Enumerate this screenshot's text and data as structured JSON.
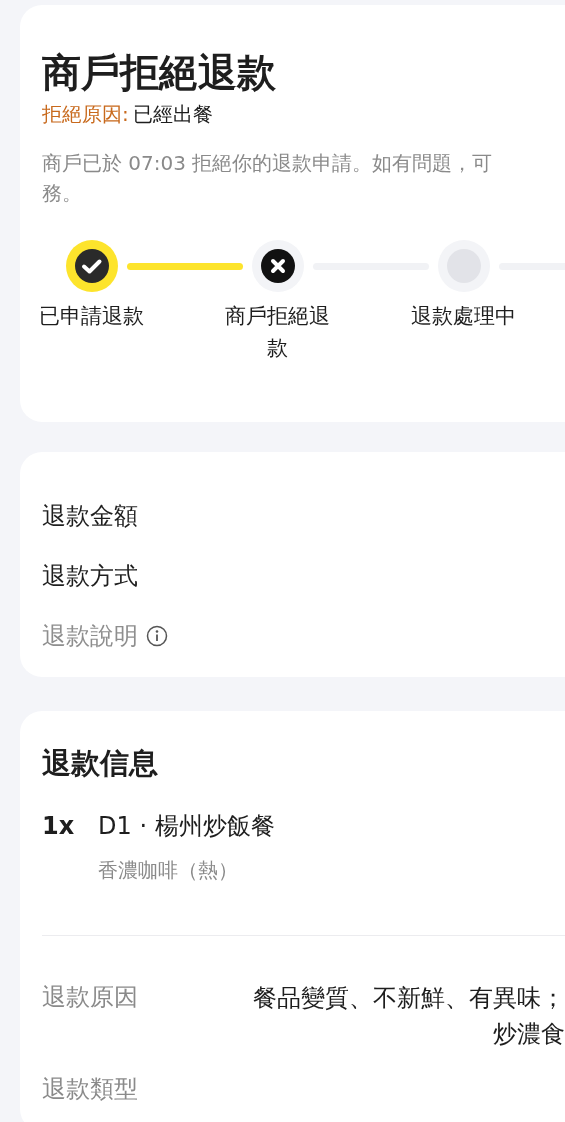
{
  "status_card": {
    "title": "商戶拒絕退款",
    "reason_label": "拒絕原因:",
    "reason_value": "已經出餐",
    "description_lines": [
      "商戶已於 07:03 拒絕你的退款申請。如有問題，可",
      "務。"
    ],
    "steps": [
      {
        "label": "已申請退款",
        "kind": "done",
        "line_active": true
      },
      {
        "label": "商戶拒絕退款",
        "kind": "rejected",
        "line_active": false
      },
      {
        "label": "退款處理中",
        "kind": "pending",
        "line_active": false
      }
    ]
  },
  "summary_card": {
    "rows": [
      {
        "label": "退款金額",
        "muted": false,
        "info_icon": false
      },
      {
        "label": "退款方式",
        "muted": false,
        "info_icon": false
      },
      {
        "label": "退款說明",
        "muted": true,
        "info_icon": true
      }
    ]
  },
  "info_card": {
    "title": "退款信息",
    "items": [
      {
        "quantity": "1x",
        "name": "D1 · 楊州炒飯餐",
        "option": "香濃咖啡（熱）"
      }
    ],
    "rows": [
      {
        "label": "退款原因",
        "value_lines": [
          "餐品變質、不新鮮、有異味；",
          "炒濃食"
        ]
      },
      {
        "label": "退款類型"
      }
    ]
  }
}
